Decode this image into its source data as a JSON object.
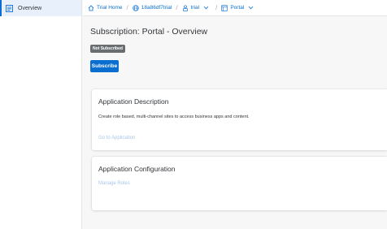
{
  "sidebar": {
    "items": [
      {
        "label": "Overview",
        "icon": "overview-icon",
        "selected": true
      }
    ]
  },
  "breadcrumb": {
    "items": [
      {
        "label": "Trial Home",
        "icon": "home-icon"
      },
      {
        "label": "18a86df7trial",
        "icon": "globe-icon"
      },
      {
        "label": "trial",
        "icon": "org-icon",
        "dropdown": true
      },
      {
        "label": "Portal",
        "icon": "portal-icon",
        "dropdown": true
      }
    ]
  },
  "page": {
    "title": "Subscription: Portal - Overview",
    "status_badge": "Not Subscribed",
    "subscribe_label": "Subscribe"
  },
  "cards": {
    "description": {
      "title": "Application Description",
      "text": "Create role based, multi-channel sites to access business apps and content.",
      "link": "Go to Application"
    },
    "configuration": {
      "title": "Application Configuration",
      "link": "Manage Roles"
    }
  },
  "colors": {
    "accent": "#0a6ed1",
    "badge": "#6a6d70",
    "disabled_link": "#a9c7ea"
  }
}
